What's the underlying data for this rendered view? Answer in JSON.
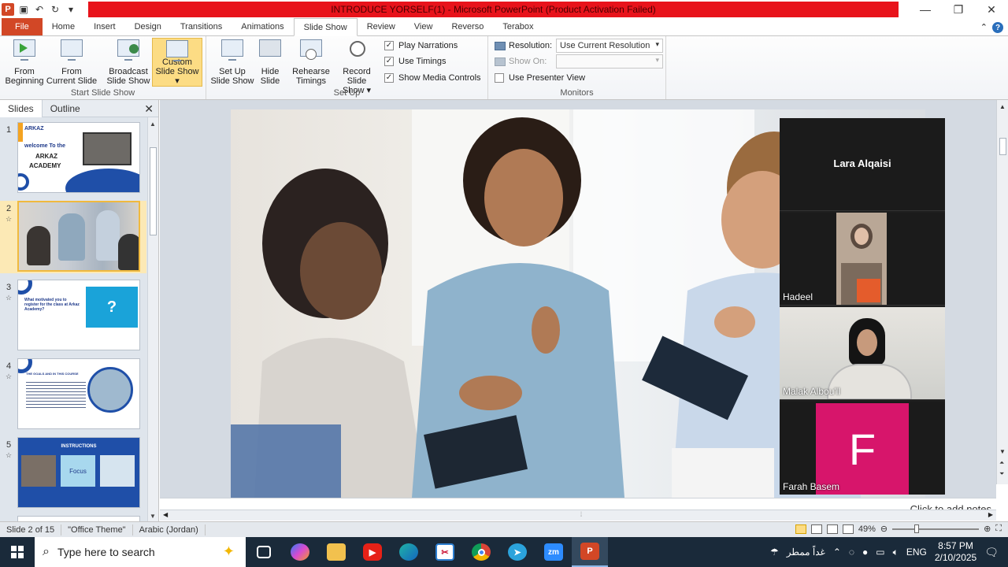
{
  "window": {
    "title": "INTRODUCE YORSELF(1) - Microsoft PowerPoint (Product Activation Failed)"
  },
  "ribbon_tabs": [
    "File",
    "Home",
    "Insert",
    "Design",
    "Transitions",
    "Animations",
    "Slide Show",
    "Review",
    "View",
    "Reverso",
    "Terabox"
  ],
  "active_tab": "Slide Show",
  "ribbon": {
    "start_group": {
      "label": "Start Slide Show",
      "from_beginning": [
        "From",
        "Beginning"
      ],
      "from_current": [
        "From",
        "Current Slide"
      ],
      "broadcast": [
        "Broadcast",
        "Slide Show"
      ],
      "custom": [
        "Custom",
        "Slide Show ▾"
      ]
    },
    "setup_group": {
      "label": "Set Up",
      "setup": [
        "Set Up",
        "Slide Show"
      ],
      "hide": [
        "Hide",
        "Slide"
      ],
      "rehearse": [
        "Rehearse",
        "Timings"
      ],
      "record": [
        "Record Slide",
        "Show ▾"
      ],
      "play_narrations": "Play Narrations",
      "use_timings": "Use Timings",
      "show_media_controls": "Show Media Controls"
    },
    "monitors_group": {
      "label": "Monitors",
      "resolution_label": "Resolution:",
      "resolution_value": "Use Current Resolution",
      "show_on_label": "Show On:",
      "presenter_view": "Use Presenter View"
    }
  },
  "pane": {
    "tabs": [
      "Slides",
      "Outline"
    ],
    "slides": [
      {
        "num": "1",
        "title_lines": [
          "welcome To the",
          "ARKAZ",
          "ACADEMY"
        ],
        "logo": "ARKAZ"
      },
      {
        "num": "2"
      },
      {
        "num": "3",
        "text": "What motivated you to register for the class at Arkaz Academy?"
      },
      {
        "num": "4",
        "text": "THE GOALS AND IN THIS COURSE"
      },
      {
        "num": "5",
        "header": "INSTRUCTIONS",
        "focus": "Focus"
      }
    ]
  },
  "notes_placeholder": "Click to add notes",
  "zoom_participants": [
    "Lara Alqaisi",
    "Hadeel",
    "Malak Albou'll",
    "Farah Basem"
  ],
  "zoom_avatar_letter": "F",
  "status": {
    "slide": "Slide 2 of 15",
    "theme": "\"Office Theme\"",
    "language": "Arabic (Jordan)",
    "zoom": "49%"
  },
  "taskbar": {
    "search_placeholder": "Type here to search",
    "weather": "غداً ممطر",
    "lang": "ENG",
    "time": "8:57 PM",
    "date": "2/10/2025"
  },
  "colors": {
    "title_bar_red": "#e8131b",
    "file_tab": "#d24726",
    "selected_button": "#fcdc84",
    "avatar_pink": "#d7156b"
  }
}
